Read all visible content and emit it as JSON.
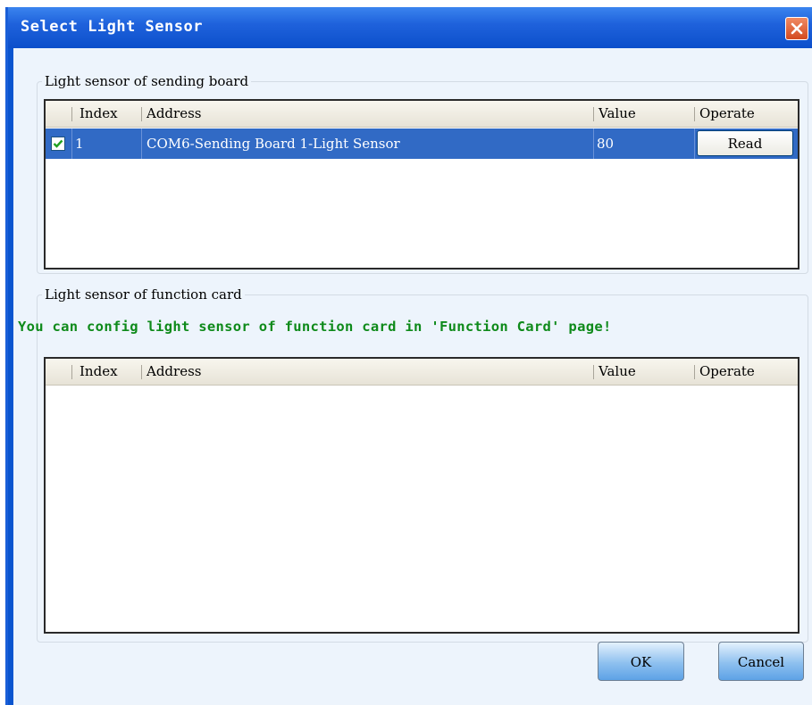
{
  "window": {
    "title": "Select Light Sensor",
    "close_icon": "close-icon"
  },
  "sending_board": {
    "group_label": "Light sensor of sending board",
    "columns": [
      "",
      "Index",
      "Address",
      "Value",
      "Operate"
    ],
    "rows": [
      {
        "checked": true,
        "index": "1",
        "address": "COM6-Sending Board 1-Light Sensor",
        "value": "80",
        "operate_label": "Read"
      }
    ]
  },
  "function_card": {
    "group_label": "Light sensor of function card",
    "notice": "You can config light sensor of function card in 'Function Card' page!",
    "columns": [
      "",
      "Index",
      "Address",
      "Value",
      "Operate"
    ],
    "rows": []
  },
  "footer": {
    "ok_label": "OK",
    "cancel_label": "Cancel"
  },
  "colors": {
    "titlebar": "#0c4fcb",
    "client_bg": "#edf4fc",
    "selected_row": "#316ac5",
    "notice_text": "#0e8a1a",
    "close_button": "#d34a1f",
    "dialog_button": "#8ec0ef"
  }
}
